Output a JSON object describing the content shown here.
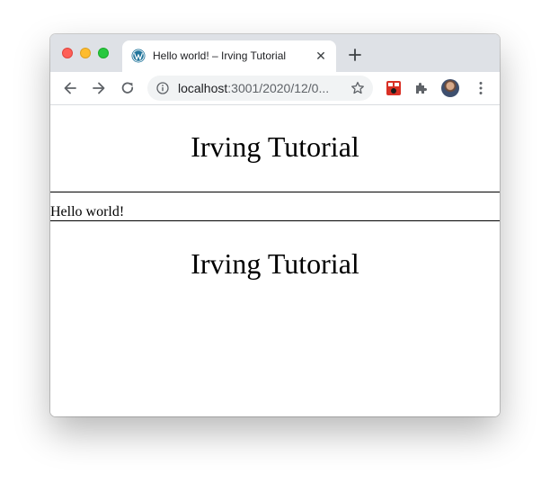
{
  "browser": {
    "tab": {
      "title": "Hello world! – Irving Tutorial",
      "favicon": "wordpress-icon"
    },
    "address_bar": {
      "host": "localhost",
      "rest": ":3001/2020/12/0..."
    },
    "colors": {
      "tabstrip": "#dee1e6",
      "omnibox": "#f1f3f4"
    }
  },
  "page": {
    "site_title_top": "Irving Tutorial",
    "post_text": "Hello world!",
    "site_title_bottom": "Irving Tutorial"
  }
}
